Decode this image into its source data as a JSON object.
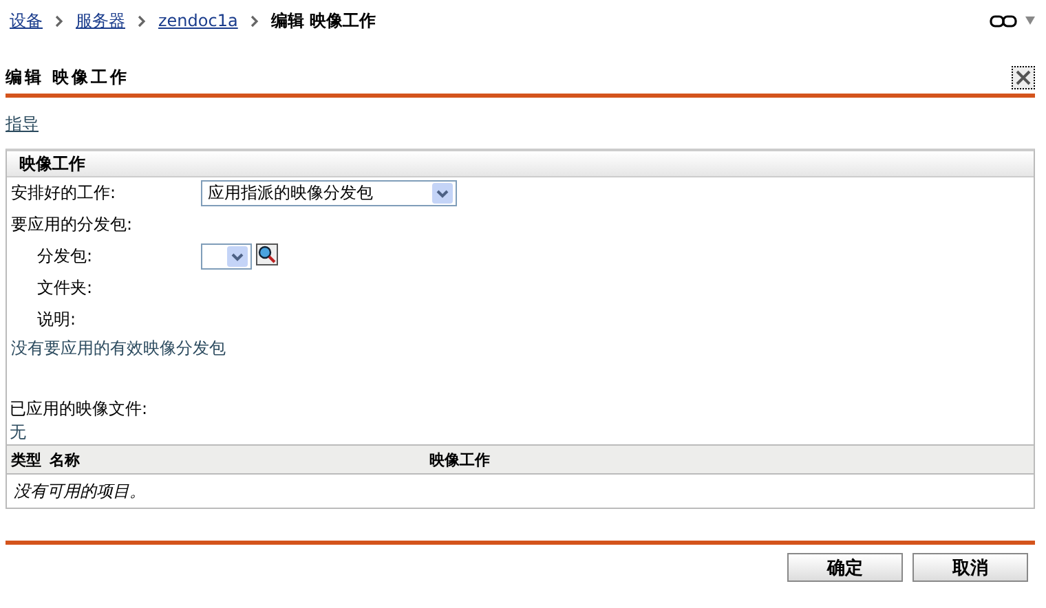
{
  "breadcrumb": [
    {
      "label": "设备",
      "link": true
    },
    {
      "label": "服务器",
      "link": true
    },
    {
      "label": "zendoc1a",
      "link": true
    },
    {
      "label": "编辑 映像工作",
      "link": false
    }
  ],
  "title": "编辑 映像工作",
  "guide_link": "指导",
  "panel": {
    "title": "映像工作",
    "scheduled_work": {
      "label": "安排好的工作:",
      "value": "应用指派的映像分发包"
    },
    "bundles_label": "要应用的分发包:",
    "fields": [
      {
        "kind": "select",
        "label": "分发包:"
      },
      {
        "kind": "text",
        "label": "文件夹:"
      },
      {
        "kind": "text",
        "label": "说明:"
      }
    ],
    "notice": "没有要应用的有效映像分发包",
    "applied_label": "已应用的映像文件:",
    "applied_value": "无",
    "table": {
      "columns": [
        "类型",
        "名称",
        "映像工作"
      ],
      "empty_text": "没有可用的项目。"
    }
  },
  "buttons": [
    "确定",
    "取消"
  ]
}
